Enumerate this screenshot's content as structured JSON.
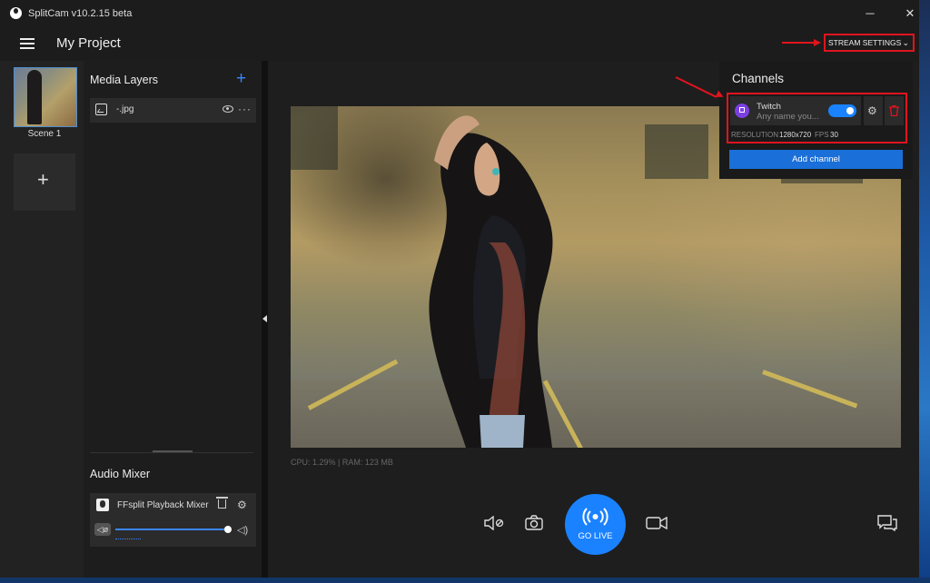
{
  "window": {
    "title": "SplitCam v10.2.15 beta",
    "minimize": "─",
    "close": "✕"
  },
  "header": {
    "project_title": "My Project",
    "stream_settings": "STREAM SETTINGS",
    "chevron": "⌄"
  },
  "scenes": {
    "items": [
      {
        "label": "Scene 1"
      }
    ],
    "add": "+"
  },
  "media_layers": {
    "title": "Media Layers",
    "add": "+",
    "items": [
      {
        "name": "-.jpg",
        "more": "···"
      }
    ]
  },
  "audio_mixer": {
    "title": "Audio Mixer",
    "items": [
      {
        "name": "FFsplit Playback Mixer",
        "volume": 1.0
      }
    ],
    "gear": "⚙",
    "speaker": "🔊"
  },
  "stats": {
    "text": "CPU: 1.29% | RAM: 123 MB"
  },
  "controls": {
    "go_live": "GO LIVE"
  },
  "channels": {
    "title": "Channels",
    "items": [
      {
        "name": "Twitch",
        "subtitle": "Any name you...",
        "enabled": true,
        "resolution_label": "RESOLUTION",
        "resolution": "1280x720",
        "fps_label": "FPS",
        "fps": "30"
      }
    ],
    "add_button": "Add channel"
  },
  "colors": {
    "accent": "#1a82ff",
    "highlight": "#e0141e",
    "twitch": "#7b3fe4",
    "delete": "#e0141e"
  }
}
